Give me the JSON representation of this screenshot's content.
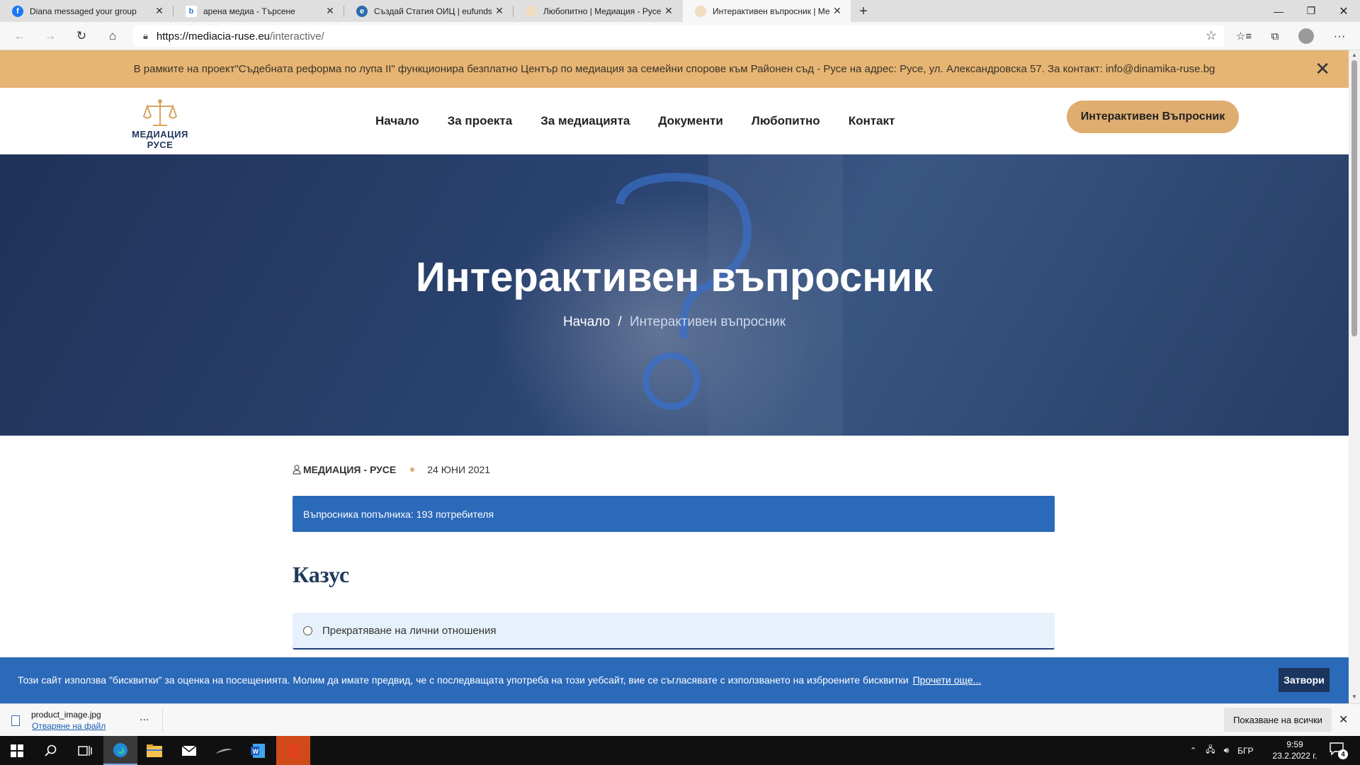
{
  "browser": {
    "tabs": [
      {
        "title": "Diana messaged your group",
        "icon": "facebook-icon",
        "color": "#1877f2",
        "glyph": "f"
      },
      {
        "title": "арена медиа - Търсене",
        "icon": "bing-search-icon",
        "color": "#2a7fd4",
        "glyph": "b"
      },
      {
        "title": "Създай Статия ОИЦ | eufunds",
        "icon": "edge-page-icon",
        "color": "#2b6cb0",
        "glyph": "e"
      },
      {
        "title": "Любопитно | Медиация - Русе",
        "icon": "site-scales-icon",
        "color": "#e6c69a",
        "glyph": ""
      },
      {
        "title": "Интерактивен въпросник | Медиация",
        "icon": "site-scales-icon",
        "color": "#e6c69a",
        "glyph": ""
      }
    ],
    "url_host": "https://mediacia-ruse.eu",
    "url_path": "/interactive/"
  },
  "notice": {
    "text": "В рамките на проект\"Съдебната реформа по лупа II\" функционира безплатно Център по медиация за семейни спорове към Районен съд - Русе на адрес: Русе, ул. Александровска 57. За контакт: info@dinamika-ruse.bg",
    "close_icon": "close-icon"
  },
  "header": {
    "logo_text": "МЕДИАЦИЯ РУСЕ",
    "nav": [
      "Начало",
      "За проекта",
      "За медиацията",
      "Документи",
      "Любопитно",
      "Контакт"
    ],
    "cta": "Интерактивен Въпросник",
    "accent": "#e0ad70"
  },
  "hero": {
    "title": "Интерактивен въпросник",
    "breadcrumb_home": "Начало",
    "breadcrumb_sep": "/",
    "breadcrumb_current": "Интерактивен въпросник"
  },
  "post": {
    "author": "Медиация - Русе",
    "date": "24 юни 2021",
    "count_text": "Въпросника попълниха: 193 потребителя",
    "case_heading": "Казус",
    "option_1": "Прекратяване на лични отношения"
  },
  "cookie": {
    "text": "Този сайт използва \"бисквитки\" за оценка на посещенията. Молим да имате предвид, че с последващата употреба на този уебсайт, вие се съгласявате с използването на изброените бисквитки",
    "link": "Прочети още...",
    "button": "Затвори",
    "color": "#2b69b9"
  },
  "downloads": {
    "file_name": "product_image.jpg",
    "open_label": "Отваряне на файл",
    "more": "...",
    "show_all": "Показване на всички"
  },
  "taskbar": {
    "lang": "БГР",
    "time": "9:59",
    "date": "23.2.2022 г.",
    "notifications": "4"
  }
}
